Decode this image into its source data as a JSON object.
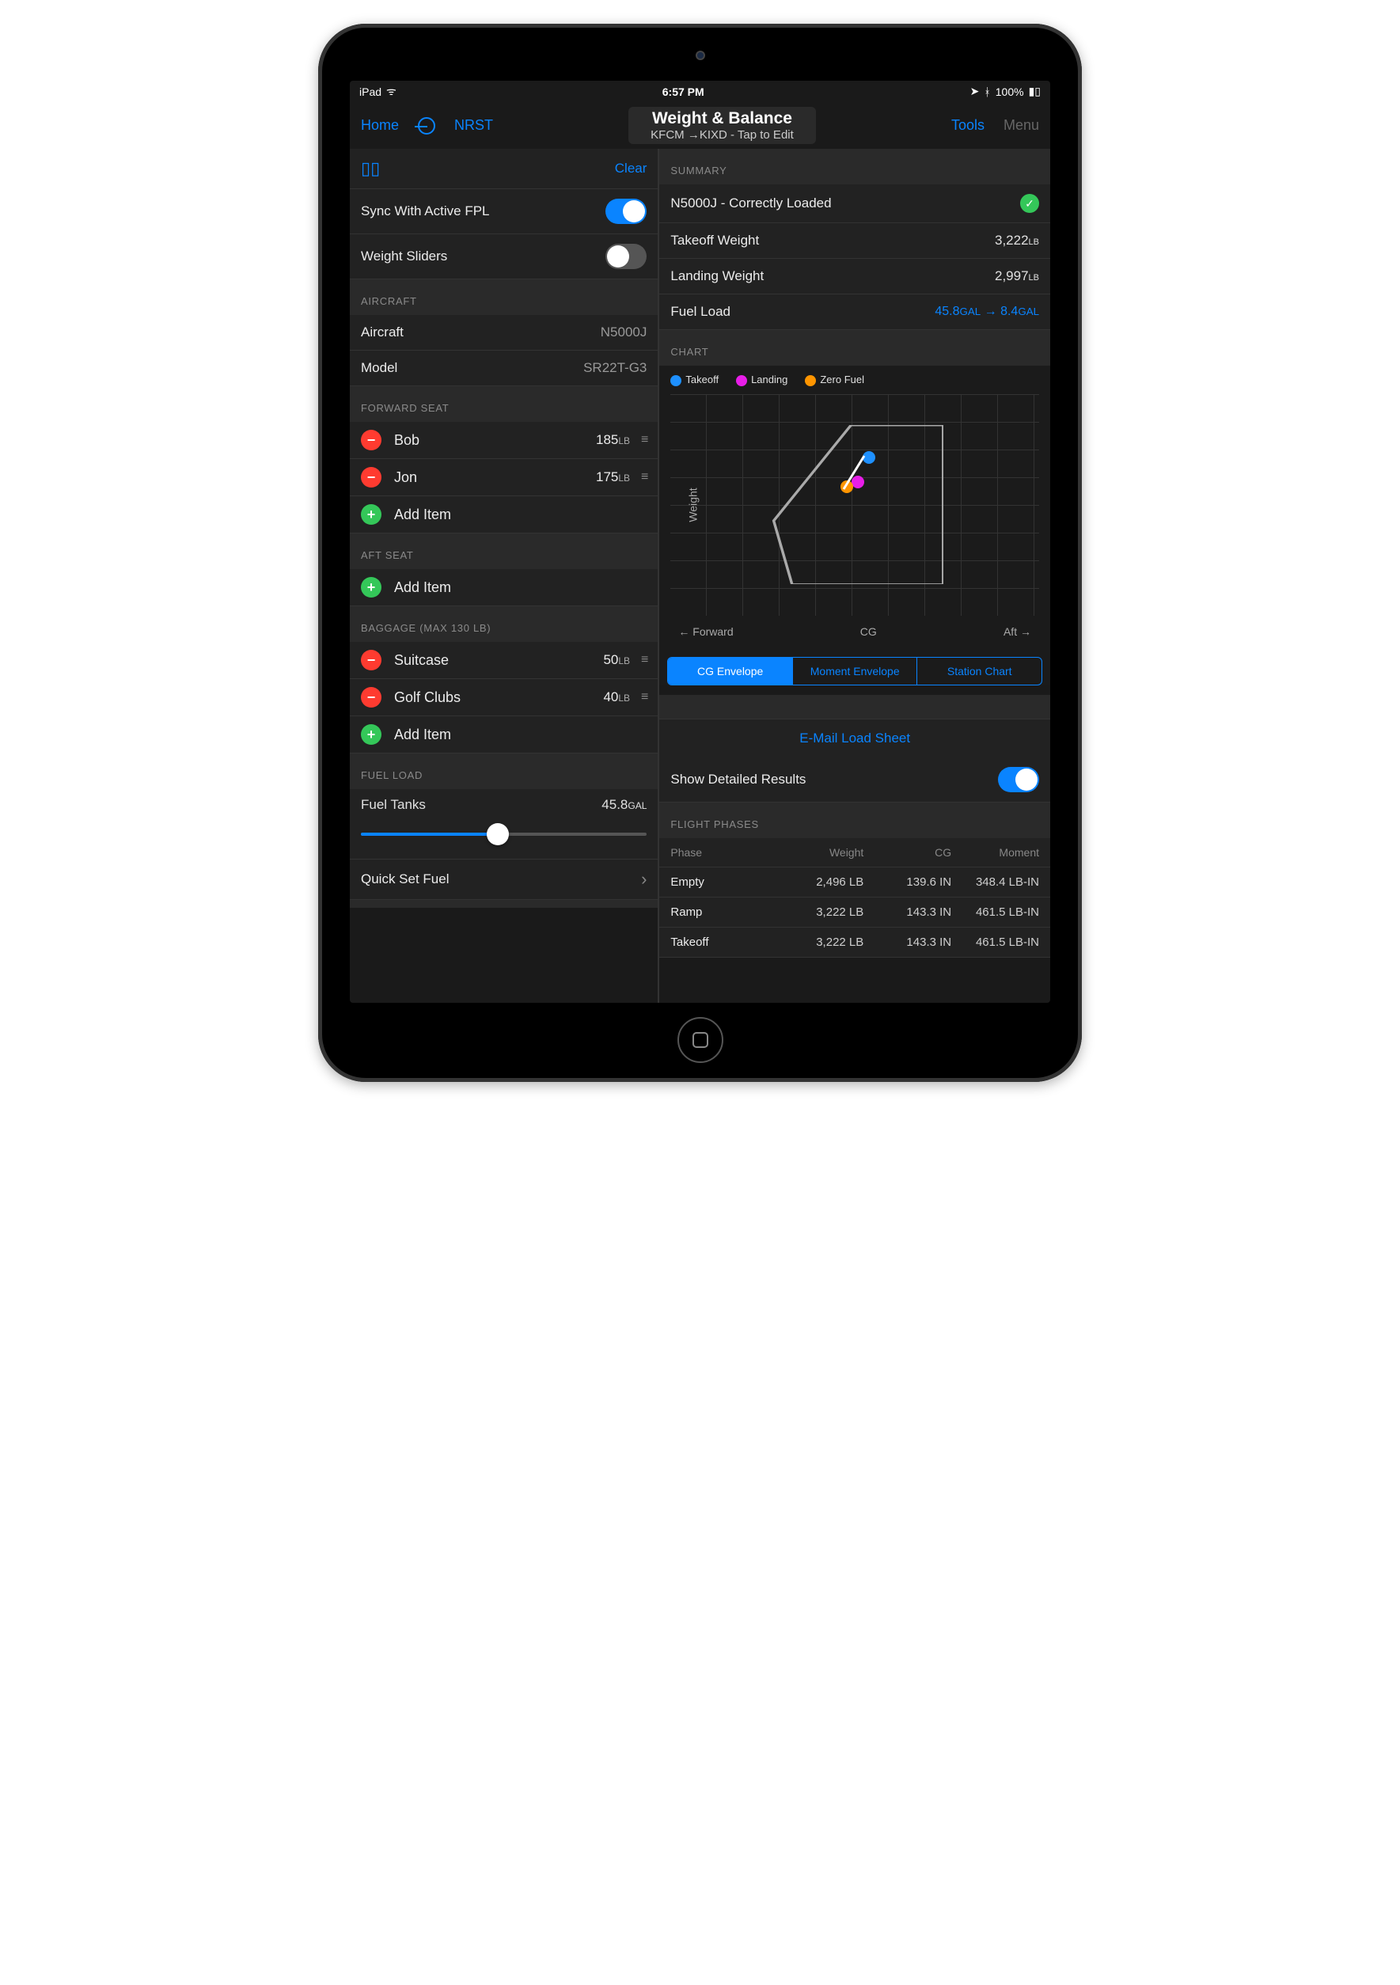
{
  "status": {
    "device": "iPad",
    "time": "6:57 PM",
    "battery": "100%"
  },
  "nav": {
    "home": "Home",
    "nrst": "NRST",
    "title": "Weight & Balance",
    "subtitle": "KFCM →KIXD - Tap to Edit",
    "tools": "Tools",
    "menu": "Menu"
  },
  "left": {
    "clear": "Clear",
    "sync": {
      "label": "Sync With Active FPL",
      "on": true
    },
    "sliders": {
      "label": "Weight Sliders",
      "on": false
    },
    "aircraft_hdr": "AIRCRAFT",
    "aircraft": {
      "label": "Aircraft",
      "value": "N5000J"
    },
    "model": {
      "label": "Model",
      "value": "SR22T-G3"
    },
    "fwd_hdr": "FORWARD SEAT",
    "fwd": [
      {
        "name": "Bob",
        "wt": "185",
        "unit": "LB"
      },
      {
        "name": "Jon",
        "wt": "175",
        "unit": "LB"
      }
    ],
    "add_item": "Add Item",
    "aft_hdr": "AFT SEAT",
    "bag_hdr": "BAGGAGE (MAX 130 LB)",
    "bag": [
      {
        "name": "Suitcase",
        "wt": "50",
        "unit": "LB"
      },
      {
        "name": "Golf Clubs",
        "wt": "40",
        "unit": "LB"
      }
    ],
    "fuel_hdr": "FUEL LOAD",
    "fuel_tanks": {
      "label": "Fuel Tanks",
      "value": "45.8",
      "unit": "GAL"
    },
    "quick_set": "Quick Set Fuel"
  },
  "right": {
    "summary_hdr": "SUMMARY",
    "status": {
      "text": "N5000J - Correctly Loaded"
    },
    "takeoff": {
      "label": "Takeoff Weight",
      "value": "3,222",
      "unit": "LB"
    },
    "landing": {
      "label": "Landing Weight",
      "value": "2,997",
      "unit": "LB"
    },
    "fuel": {
      "label": "Fuel Load",
      "from": "45.8",
      "from_unit": "GAL",
      "to": "8.4",
      "to_unit": "GAL"
    },
    "chart_hdr": "CHART",
    "legend": {
      "takeoff": "Takeoff",
      "landing": "Landing",
      "zero": "Zero Fuel"
    },
    "ylabel": "Weight",
    "xlabel_cg": "CG",
    "xlabel_fwd": "← Forward",
    "xlabel_aft": "Aft →",
    "segs": {
      "cg": "CG Envelope",
      "moment": "Moment Envelope",
      "station": "Station Chart"
    },
    "email": "E-Mail Load Sheet",
    "detailed": {
      "label": "Show Detailed Results",
      "on": true
    },
    "phases_hdr": "FLIGHT PHASES",
    "cols": {
      "phase": "Phase",
      "weight": "Weight",
      "cg": "CG",
      "moment": "Moment"
    },
    "rows": [
      {
        "phase": "Empty",
        "weight": "2,496 LB",
        "cg": "139.6 IN",
        "moment": "348.4 LB-IN"
      },
      {
        "phase": "Ramp",
        "weight": "3,222 LB",
        "cg": "143.3 IN",
        "moment": "461.5 LB-IN"
      },
      {
        "phase": "Takeoff",
        "weight": "3,222 LB",
        "cg": "143.3 IN",
        "moment": "461.5 LB-IN"
      }
    ]
  },
  "chart_data": {
    "type": "scatter",
    "title": "CG Envelope",
    "xlabel": "CG",
    "ylabel": "Weight",
    "series": [
      {
        "name": "Takeoff",
        "cg": 143.3,
        "weight": 3222,
        "color": "#1e90ff"
      },
      {
        "name": "Landing",
        "cg": 142.8,
        "weight": 2997,
        "color": "#e81ee8"
      },
      {
        "name": "Zero Fuel",
        "cg": 142.3,
        "weight": 2947,
        "color": "#ff9500"
      }
    ],
    "envelope_note": "Polygonal weight/CG operating envelope shown; exact vertex coordinates not labeled on chart"
  }
}
